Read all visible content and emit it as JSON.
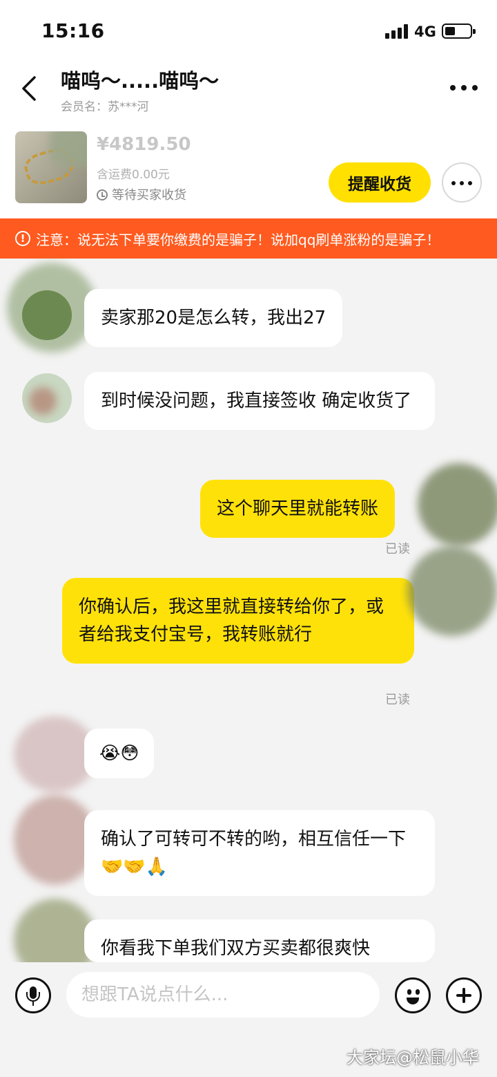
{
  "status_bar": {
    "time": "15:16",
    "network": "4G"
  },
  "header": {
    "title": "喵呜～.....喵呜～",
    "member": "会员名：苏***河"
  },
  "order": {
    "price": "¥4819.50",
    "freight": "含运费0.00元",
    "status": "等待买家收货",
    "remind_label": "提醒收货"
  },
  "warning": {
    "text": "注意：说无法下单要你缴费的是骗子！说加qq刷单涨粉的是骗子！"
  },
  "messages": [
    {
      "side": "in",
      "text": "卖家那20是怎么转，我出27"
    },
    {
      "side": "in",
      "text": "到时候没问题，我直接签收 确定收货了"
    },
    {
      "side": "out",
      "text": "这个聊天里就能转账",
      "read": "已读"
    },
    {
      "side": "out",
      "text": "你确认后，我这里就直接转给你了，或者给我支付宝号，我转账就行",
      "read": "已读"
    },
    {
      "side": "in",
      "text": "😭😳"
    },
    {
      "side": "in",
      "text": "确认了可转可不转的哟，相互信任一下 🤝🤝🙏"
    },
    {
      "side": "in",
      "text": "你看我下单我们双方买卖都很爽快"
    }
  ],
  "input": {
    "placeholder": "想跟TA说点什么..."
  },
  "icons": {
    "back": "back-arrow-icon",
    "more": "more-dots-icon",
    "mic": "microphone-icon",
    "emoji": "emoji-icon",
    "plus": "plus-icon",
    "clock": "clock-icon",
    "warning": "warning-icon"
  },
  "colors": {
    "accent": "#ffe000",
    "warning_bg": "#ff5a1f",
    "bubble_out": "#ffe10a"
  },
  "watermark": "大家坛@松鼠小华"
}
